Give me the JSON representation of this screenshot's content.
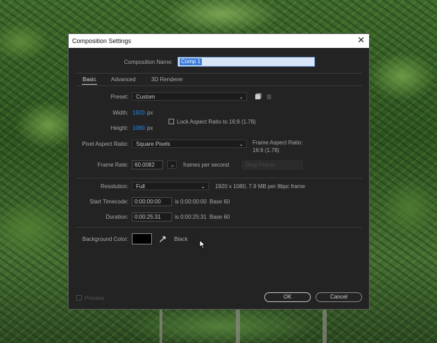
{
  "dialog": {
    "title": "Composition Settings",
    "close_glyph": "✕",
    "composition_name_label": "Composition Name:",
    "composition_name_value": "Comp 1",
    "tabs": [
      {
        "label": "Basic",
        "active": true
      },
      {
        "label": "Advanced",
        "active": false
      },
      {
        "label": "3D Renderer",
        "active": false
      }
    ],
    "preset": {
      "label": "Preset:",
      "value": "Custom"
    },
    "width": {
      "label": "Width:",
      "value": "1920",
      "unit": "px"
    },
    "height": {
      "label": "Height:",
      "value": "1080",
      "unit": "px"
    },
    "lock_aspect": {
      "label": "Lock Aspect Ratio to 16:9 (1.78)",
      "checked": false
    },
    "pixel_aspect": {
      "label": "Pixel Aspect Ratio:",
      "value": "Square Pixels",
      "frame_aspect_label": "Frame Aspect Ratio:",
      "frame_aspect_value": "16:9 (1.78)"
    },
    "frame_rate": {
      "label": "Frame Rate:",
      "value": "60.0082",
      "unit": "frames per second",
      "drop_frame": "Drop Frame"
    },
    "resolution": {
      "label": "Resolution:",
      "value": "Full",
      "info": "1920 x 1080, 7.9 MB per 8bpc frame"
    },
    "start_timecode": {
      "label": "Start Timecode:",
      "value": "0:00:00:00",
      "is_text": "is 0:00:00:00",
      "base": "Base 60"
    },
    "duration": {
      "label": "Duration:",
      "value": "0:00:25:31",
      "is_text": "is 0:00:25:31",
      "base": "Base 60"
    },
    "background": {
      "label": "Background Color:",
      "color": "#000000",
      "name": "Black"
    },
    "preview": {
      "label": "Preview",
      "checked": false
    },
    "ok_label": "OK",
    "cancel_label": "Cancel"
  },
  "icons": {
    "dropdown": "chevron-down-icon",
    "eyedropper": "eyedropper-icon",
    "new_preset": "save-preset-icon",
    "delete_preset": "delete-preset-icon"
  },
  "colors": {
    "dialog_bg": "#232323",
    "accent_blue": "#2d8ceb",
    "selection_bg": "#3b7bd5"
  }
}
